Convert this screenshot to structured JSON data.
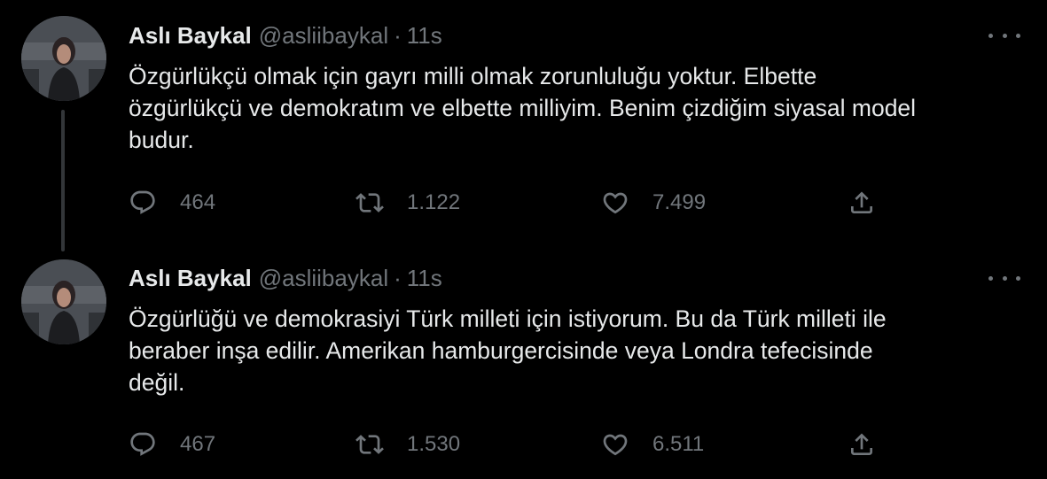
{
  "tweets": [
    {
      "author_name": "Aslı Baykal",
      "handle": "@asliibaykal",
      "separator": "·",
      "time": "11s",
      "text": "Özgürlükçü olmak için gayrı milli olmak zorunluluğu yoktur. Elbette\nözgürlükçü ve demokratım ve elbette milliyim. Benim çizdiğim siyasal model\nbudur.",
      "reply_count": "464",
      "retweet_count": "1.122",
      "like_count": "7.499",
      "icons": {
        "reply": "reply-icon",
        "retweet": "retweet-icon",
        "like": "heart-icon",
        "share": "share-icon",
        "more": "more-icon"
      }
    },
    {
      "author_name": "Aslı Baykal",
      "handle": "@asliibaykal",
      "separator": "·",
      "time": "11s",
      "text": "Özgürlüğü ve demokrasiyi Türk milleti için istiyorum. Bu da Türk milleti ile\nberaber inşa edilir. Amerikan hamburgercisinde veya Londra tefecisinde\ndeğil.",
      "reply_count": "467",
      "retweet_count": "1.530",
      "like_count": "6.511",
      "icons": {
        "reply": "reply-icon",
        "retweet": "retweet-icon",
        "like": "heart-icon",
        "share": "share-icon",
        "more": "more-icon"
      }
    }
  ],
  "colors": {
    "background": "#000000",
    "primary_text": "#e7e9ea",
    "secondary_text": "#71767b",
    "thread_line": "#333639"
  }
}
